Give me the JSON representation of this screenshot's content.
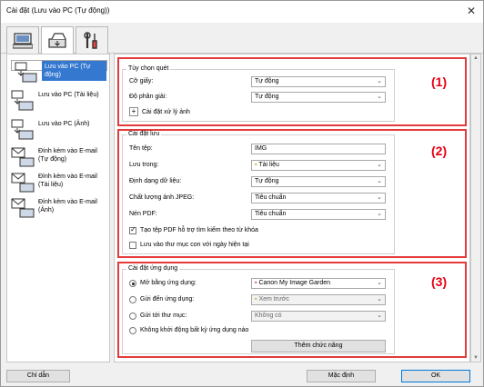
{
  "window": {
    "title": "Cài đặt (Lưu vào PC (Tự động))",
    "close_glyph": "✕"
  },
  "top_tabs": [
    {
      "icon": "scan-from-computer-icon"
    },
    {
      "icon": "scan-from-operation-panel-icon"
    },
    {
      "icon": "general-settings-icon"
    }
  ],
  "sidebar": {
    "items": [
      {
        "label": "Lưu vào PC (Tự động)",
        "icon": "save-to-pc-auto-icon",
        "selected": true
      },
      {
        "label": "Lưu vào PC (Tài liệu)",
        "icon": "save-to-pc-document-icon"
      },
      {
        "label": "Lưu vào PC (Ảnh)",
        "icon": "save-to-pc-photo-icon"
      },
      {
        "label": "Đính kèm vào E-mail (Tự động)",
        "icon": "attach-email-auto-icon"
      },
      {
        "label": "Đính kèm vào E-mail (Tài liệu)",
        "icon": "attach-email-document-icon"
      },
      {
        "label": "Đính kèm vào E-mail (Ảnh)",
        "icon": "attach-email-photo-icon"
      }
    ]
  },
  "scan_options": {
    "title": "Tùy chọn quét",
    "paper_label": "Cỡ giấy:",
    "paper_value": "Tự động",
    "resolution_label": "Độ phân giải:",
    "resolution_value": "Tự động",
    "image_processing_label": "Cài đặt xử lý ảnh",
    "section_number": "(1)"
  },
  "save_settings": {
    "title": "Cài đặt lưu",
    "filename_label": "Tên tệp:",
    "filename_value": "IMG",
    "save_in_label": "Lưu trong:",
    "save_in_value": "Tài liệu",
    "format_label": "Định dạng dữ liệu:",
    "format_value": "Tự động",
    "jpeg_label": "Chất lượng ảnh JPEG:",
    "jpeg_value": "Tiêu chuẩn",
    "pdf_label": "Nén PDF:",
    "pdf_value": "Tiêu chuẩn",
    "keyword_pdf_label": "Tạo tệp PDF hỗ trợ tìm kiếm theo từ khóa",
    "keyword_pdf_checked": true,
    "subfolder_label": "Lưu vào thư mục con với ngày hiện tại",
    "subfolder_checked": false,
    "section_number": "(2)"
  },
  "app_settings": {
    "title": "Cài đặt ứng dụng",
    "open_app_label": "Mở bằng ứng dụng:",
    "open_app_value": "Canon My Image Garden",
    "send_app_label": "Gửi đến ứng dụng:",
    "send_app_value": "Xem trước",
    "send_folder_label": "Gửi tới thư mục:",
    "send_folder_value": "Không có",
    "no_app_label": "Không khởi động bất kỳ ứng dụng nào",
    "add_function_label": "Thêm chức năng",
    "selected_option": "open_app",
    "section_number": "(3)"
  },
  "footer": {
    "help_label": "Chỉ dẫn",
    "default_label": "Mặc định",
    "ok_label": "OK"
  },
  "colors": {
    "highlight_box": "#e43a3a",
    "section_number": "#e60012",
    "selected_item": "#3478d0"
  }
}
